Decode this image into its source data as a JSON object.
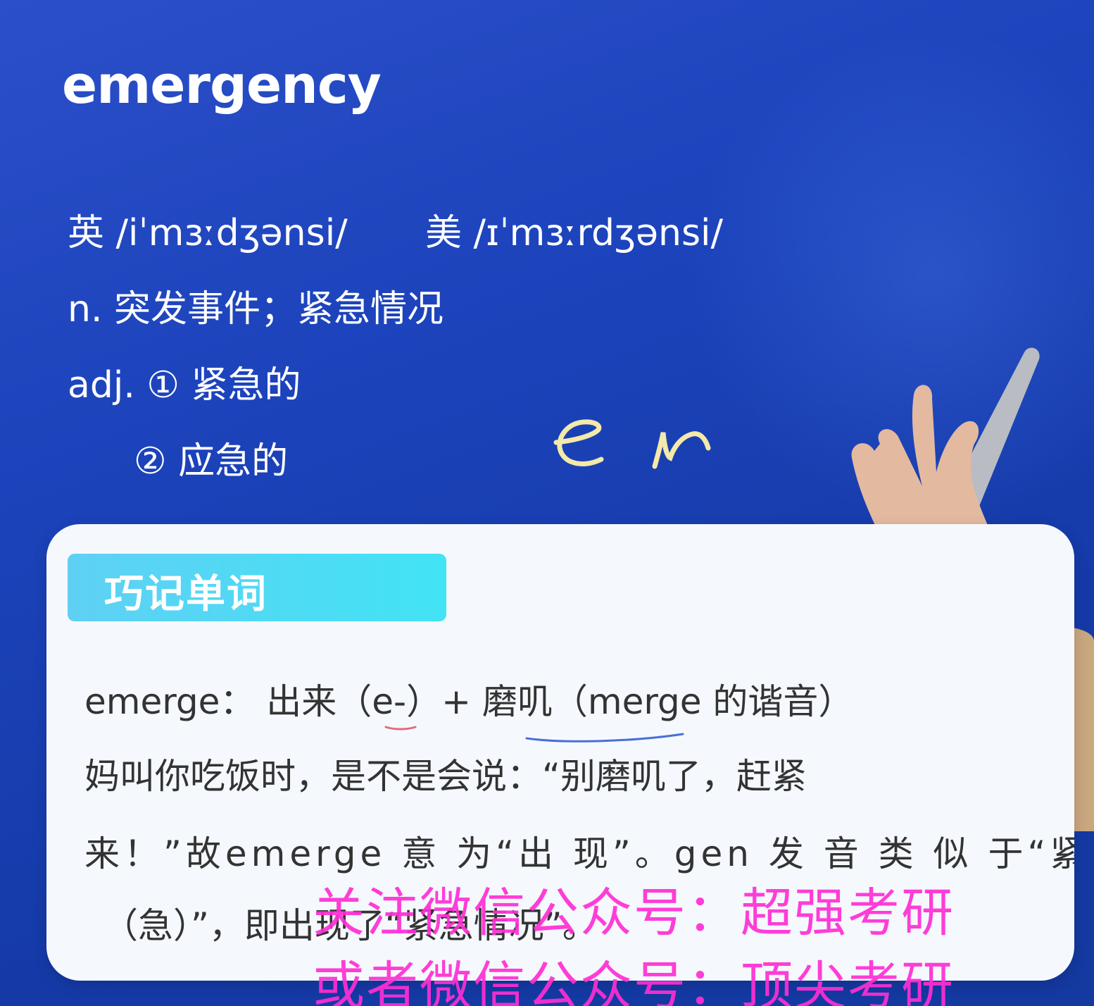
{
  "slide": {
    "word": "emergency",
    "pronunciation_uk": "英 /iˈmɜːdʒənsi/",
    "pronunciation_us": "美 /ɪˈmɜːrdʒənsi/",
    "def_noun": "n. 突发事件；紧急情况",
    "def_adj_1": "adj. ① 紧急的",
    "def_adj_2": "② 应急的",
    "handwriting": "e r"
  },
  "card": {
    "tag_label": "巧记单词",
    "line_1": "emerge： 出来（e-）+ 磨叽（merge 的谐音）",
    "line_2": "妈叫你吃饭时，是不是会说：“别磨叽了，赶紧",
    "line_3": "来！”故emerge 意 为“出 现”。gen 发 音 类 似 于“紧",
    "line_4": "（急）”，即出现了“紧急情况”。"
  },
  "watermark": {
    "line_1": "关注微信公众号：超强考研",
    "line_2": "或者微信公众号：顶尖考研"
  },
  "colors": {
    "background": "#1c43bb",
    "card": "#f5f8fd",
    "tag": "#42e3f5",
    "watermark": "#ff2ed4",
    "handwriting": "#f3e9a8"
  }
}
